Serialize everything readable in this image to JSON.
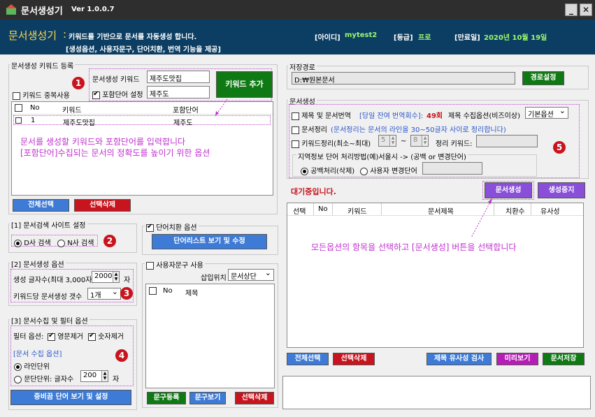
{
  "window": {
    "title": "문서생성기",
    "version": "Ver 1.0.0.7",
    "minimize": "_",
    "close": "✕"
  },
  "header": {
    "title": "문서생성기",
    "colon": ":",
    "desc": "키워드를 기반으로 문서를 자동생성 합니다.",
    "sub": "[생성옵션, 사용자문구, 단어치환, 번역 기능을 제공]",
    "id_label": "[아이디]",
    "id_value": "mytest2",
    "grade_label": "[등급]",
    "grade_value": "프로",
    "expire_label": "[만료일]",
    "expire_value": "2020년 10월 19일"
  },
  "keyword_section": {
    "title": "문서생성 키워드 등록",
    "dup_label": "키워드 중복사용",
    "keyword_label": "문서생성 키워드",
    "keyword_value": "제주도맛집",
    "include_label": "포함단어 설정",
    "include_value": "제주도",
    "add_button": "키워드 추가",
    "columns": [
      "No",
      "키워드",
      "포함단어"
    ],
    "rows": [
      {
        "no": "1",
        "keyword": "제주도맛집",
        "include": "제주도"
      }
    ],
    "note_line1": "문서를 생성할 키워드와 포함단어를 입력합니다",
    "note_line2": "[포함단어]수집되는 문서의 정확도를 높이기 위한 옵션",
    "select_all": "전체선택",
    "delete_selected": "선택삭제"
  },
  "search_site": {
    "title": "[1] 문서검색 사이트 설정",
    "opt_d": "D사 검색",
    "opt_n": "N사 검색"
  },
  "gen_options": {
    "title": "[2] 문서생성 옵션",
    "char_label": "생성 글자수(최대 3,000자)",
    "char_value": "2000",
    "char_unit": "자",
    "per_kw_label": "키워드당 문서생성 갯수",
    "per_kw_value": "1개"
  },
  "collect_options": {
    "title": "[3] 문서수집 및 필터 옵션",
    "filter_label": "필터 옵션:",
    "filter_eng": "영문제거",
    "filter_num": "숫자제거",
    "collect_title": "[문서 수집 옵션]",
    "line_unit": "라인단위",
    "para_unit": "문단단위:",
    "char_count_label": "글자수",
    "char_count_value": "200",
    "char_unit": "자",
    "stopword_button": "중비끔 단어 보기 및 설정"
  },
  "replace": {
    "title": "단어치환 옵션",
    "button": "단어리스트 보기 및 수정"
  },
  "phrases": {
    "title": "사용자문구 사용",
    "insert_label": "삽입위치",
    "insert_value": "문서상단",
    "columns": [
      "No",
      "제목"
    ],
    "register": "문구등록",
    "view": "문구보기",
    "delete": "선택삭제"
  },
  "save": {
    "title": "저장경로",
    "path": "D:₩원본문서",
    "button": "경로설정"
  },
  "docgen": {
    "title": "문서생성",
    "translate_label": "제목 및 문서번역",
    "translate_remaining": "[당일 잔여 번역회수]:",
    "translate_count": "49회",
    "title_collect_label": "제목 수집옵션(비즈이상)",
    "title_collect_value": "기본옵션",
    "arrange_label": "문서정리",
    "arrange_desc": "(문서정리는 문서의 라인을 30~50글자 사이로 정리합니다)",
    "kw_arrange_label": "키워드정리(최소~최대)",
    "kw_min": "5",
    "kw_tilde": "~",
    "kw_max": "8",
    "arrange_kw_label": "정리 키워드:",
    "region_label": "지역정보 단어 처리방법(예)서울시 -> (공백 or 변경단어)",
    "blank_label": "공백처리(삭제)",
    "user_change_label": "사용자 변경단어"
  },
  "status": "대기중입니다.",
  "actions": {
    "generate": "문서생성",
    "stop": "생성중지"
  },
  "result": {
    "columns": [
      "선택",
      "No",
      "키워드",
      "문서제목",
      "치환수",
      "유사성"
    ],
    "note": "모든옵션의 항목을 선택하고 [문서생성] 버튼을 선택합니다",
    "select_all": "전체선택",
    "delete": "선택삭제",
    "similarity": "제목 유사성 검사",
    "preview": "미리보기",
    "save": "문서저장"
  },
  "badges": [
    "1",
    "2",
    "3",
    "4",
    "5"
  ]
}
